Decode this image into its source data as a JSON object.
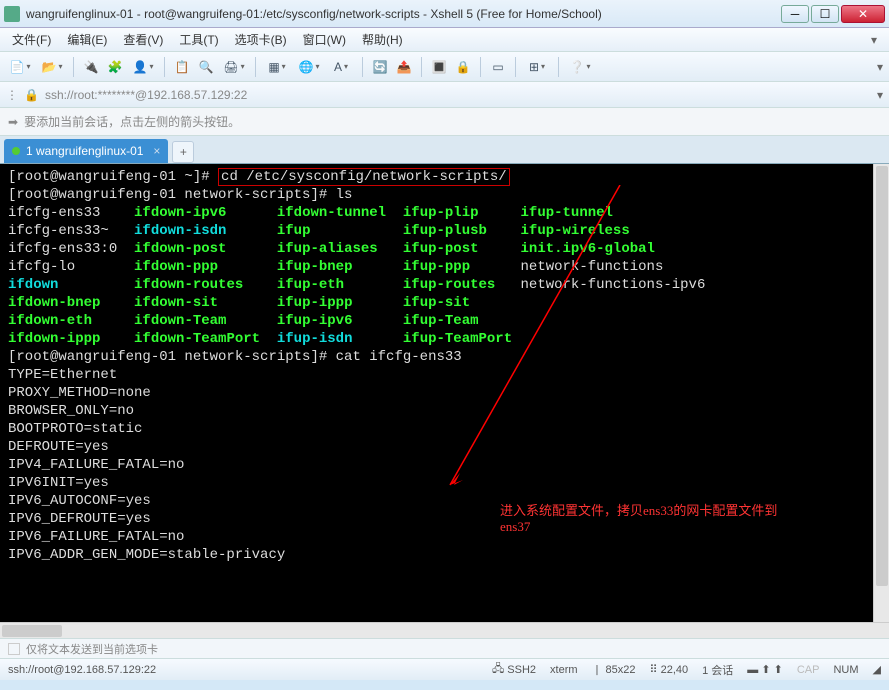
{
  "window": {
    "title": "wangruifenglinux-01 - root@wangruifeng-01:/etc/sysconfig/network-scripts - Xshell 5 (Free for Home/School)"
  },
  "menu": {
    "file": "文件(F)",
    "edit": "编辑(E)",
    "view": "查看(V)",
    "tools": "工具(T)",
    "tabs": "选项卡(B)",
    "window": "窗口(W)",
    "help": "帮助(H)"
  },
  "address": {
    "text": "ssh://root:********@192.168.57.129:22"
  },
  "hint": {
    "text": "要添加当前会话，点击左侧的箭头按钮。"
  },
  "tab": {
    "label": "1 wangruifenglinux-01"
  },
  "terminal": {
    "prompt1_a": "[root@wangruifeng-01 ~]# ",
    "prompt1_cmd": "cd /etc/sysconfig/network-scripts/",
    "prompt2": "[root@wangruifeng-01 network-scripts]# ls",
    "ls_rows": [
      [
        "ifcfg-ens33",
        "ifdown-ipv6",
        "ifdown-tunnel",
        "ifup-plip",
        "ifup-tunnel"
      ],
      [
        "ifcfg-ens33~",
        "ifdown-isdn",
        "ifup",
        "ifup-plusb",
        "ifup-wireless"
      ],
      [
        "ifcfg-ens33:0",
        "ifdown-post",
        "ifup-aliases",
        "ifup-post",
        "init.ipv6-global"
      ],
      [
        "ifcfg-lo",
        "ifdown-ppp",
        "ifup-bnep",
        "ifup-ppp",
        "network-functions"
      ],
      [
        "ifdown",
        "ifdown-routes",
        "ifup-eth",
        "ifup-routes",
        "network-functions-ipv6"
      ],
      [
        "ifdown-bnep",
        "ifdown-sit",
        "ifup-ippp",
        "ifup-sit",
        ""
      ],
      [
        "ifdown-eth",
        "ifdown-Team",
        "ifup-ipv6",
        "ifup-Team",
        ""
      ],
      [
        "ifdown-ippp",
        "ifdown-TeamPort",
        "ifup-isdn",
        "ifup-TeamPort",
        ""
      ]
    ],
    "ls_colors": [
      [
        "w",
        "g",
        "g",
        "g",
        "g"
      ],
      [
        "w",
        "c",
        "g",
        "g",
        "g"
      ],
      [
        "w",
        "g",
        "g",
        "g",
        "g"
      ],
      [
        "w",
        "g",
        "g",
        "g",
        "w"
      ],
      [
        "c",
        "g",
        "g",
        "g",
        "w"
      ],
      [
        "g",
        "g",
        "g",
        "g",
        ""
      ],
      [
        "g",
        "g",
        "g",
        "g",
        ""
      ],
      [
        "g",
        "g",
        "c",
        "g",
        ""
      ]
    ],
    "prompt3": "[root@wangruifeng-01 network-scripts]# cat ifcfg-ens33",
    "cat_lines": [
      "TYPE=Ethernet",
      "PROXY_METHOD=none",
      "BROWSER_ONLY=no",
      "BOOTPROTO=static",
      "DEFROUTE=yes",
      "IPV4_FAILURE_FATAL=no",
      "IPV6INIT=yes",
      "IPV6_AUTOCONF=yes",
      "IPV6_DEFROUTE=yes",
      "IPV6_FAILURE_FATAL=no",
      "IPV6_ADDR_GEN_MODE=stable-privacy"
    ]
  },
  "annotation": {
    "text1": "进入系统配置文件，拷贝ens33的网卡配置文件到",
    "text2": "ens37"
  },
  "footer1": {
    "text": "仅将文本发送到当前选项卡"
  },
  "status": {
    "conn": "ssh://root@192.168.57.129:22",
    "proto": "SSH2",
    "term": "xterm",
    "size": "85x22",
    "pos": "22,40",
    "sess": "1 会话",
    "cap": "CAP",
    "num": "NUM"
  }
}
